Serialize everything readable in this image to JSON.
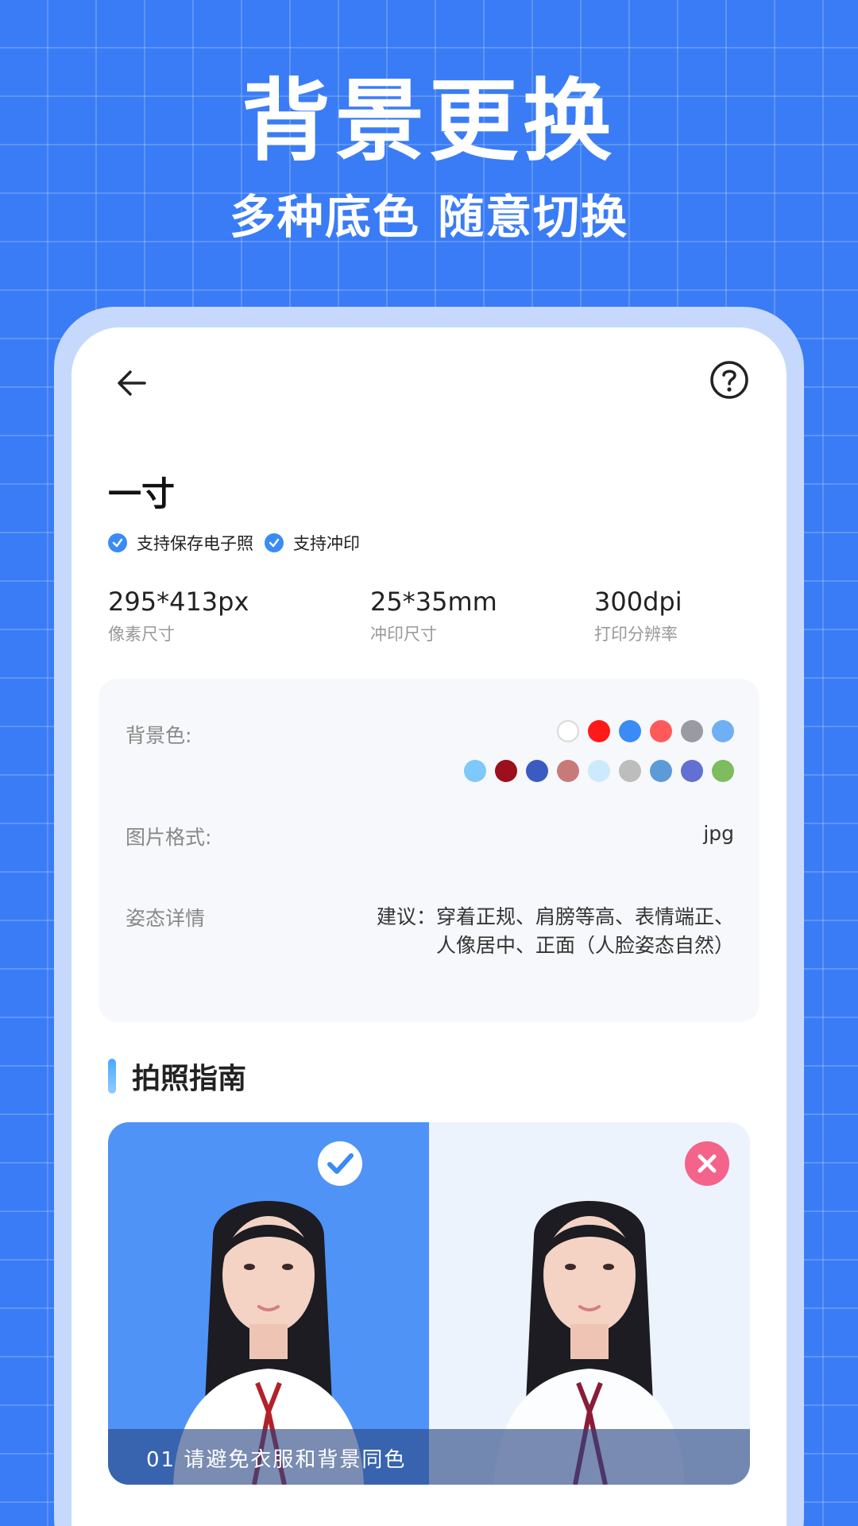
{
  "hero": {
    "title": "背景更换",
    "subtitle": "多种底色 随意切换"
  },
  "nav": {
    "back_icon": "arrow-left-icon",
    "help_icon": "question-circle-icon"
  },
  "spec": {
    "title": "一寸",
    "supports": [
      "支持保存电子照",
      "支持冲印"
    ],
    "stats": [
      {
        "value": "295*413px",
        "label": "像素尺寸"
      },
      {
        "value": "25*35mm",
        "label": "冲印尺寸"
      },
      {
        "value": "300dpi",
        "label": "打印分辨率"
      }
    ]
  },
  "info": {
    "bg_label": "背景色:",
    "bg_colors_row1": [
      "#ffffff",
      "#ff1a1a",
      "#3a8bf5",
      "#ff5a5a",
      "#9a9aa2",
      "#6fb0f5"
    ],
    "bg_colors_row2": [
      "#7ec9fa",
      "#9c0f1c",
      "#3b5bc2",
      "#c87a7a",
      "#cdeafc",
      "#bdbdbd",
      "#5d9ad8",
      "#6270d3",
      "#7dbd5f"
    ],
    "format_label": "图片格式:",
    "format_value": "jpg",
    "posture_label": "姿态详情",
    "posture_value": "建议：穿着正规、肩膀等高、表情端正、人像居中、正面（人脸姿态自然）"
  },
  "guide": {
    "section_title": "拍照指南",
    "caption": "01 请避免衣服和背景同色",
    "good_icon": "check-circle-icon",
    "bad_icon": "close-circle-icon"
  }
}
